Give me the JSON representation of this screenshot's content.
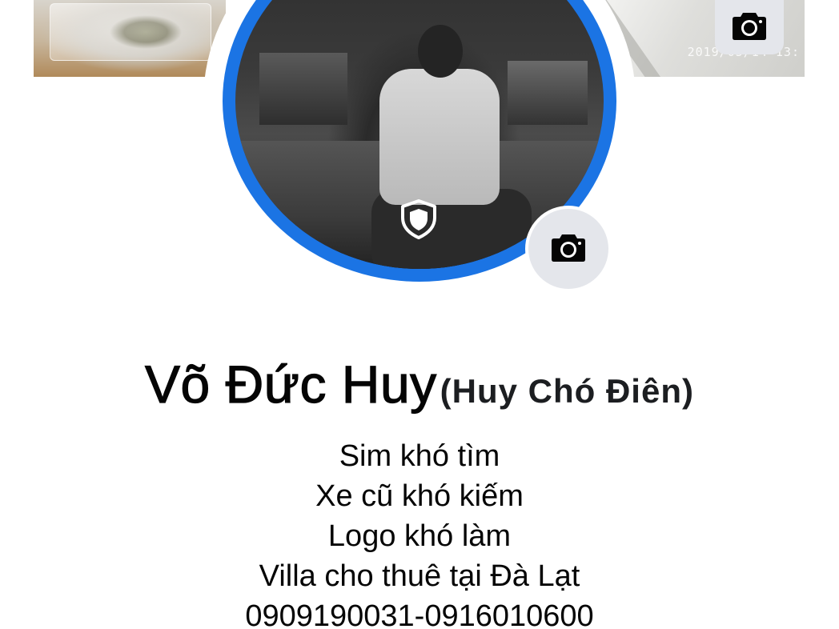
{
  "cover": {
    "timestamp": "2019/05/14 13:",
    "camera_icon": "camera-icon"
  },
  "avatar": {
    "ring_color": "#1b74e4",
    "badge_icon": "shield-icon",
    "camera_icon": "camera-icon"
  },
  "profile": {
    "name": "Võ Đức Huy",
    "alternate_name": "(Huy Chó Điên)",
    "bio_lines": [
      "Sim khó tìm",
      "Xe cũ khó kiếm",
      "Logo khó làm",
      "Villa cho thuê tại Đà Lạt",
      "0909190031-0916010600"
    ]
  }
}
